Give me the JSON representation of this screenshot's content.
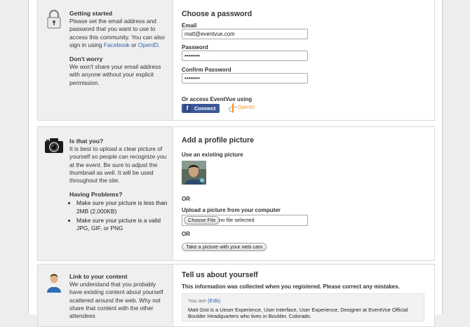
{
  "password_section": {
    "sidebar": {
      "heading1": "Getting started",
      "text1_pre": "Please set the email address and password that you want to use to access this community. You can also sign in using ",
      "link_facebook": "Facebook",
      "text_or": " or ",
      "link_openid": "OpenID",
      "text_end": ".",
      "heading2": "Don't worry",
      "text2": "We won't share your email address with anyone without your explicit permission."
    },
    "title": "Choose a password",
    "email_label": "Email",
    "email_value": "matt@eventvue.com",
    "password_label": "Password",
    "password_value": "••••••••",
    "confirm_label": "Confirm Password",
    "confirm_value": "••••••••",
    "access_label": "Or access EventVue using",
    "facebook_button": "Connect",
    "openid_button": "OpenID"
  },
  "picture_section": {
    "sidebar": {
      "heading1": "Is that you?",
      "text1": "It is best to upload a clear picture of yourself so people can recognize you at the event. Be sure to adjust the thumbnail as well. It will be used throughout the site.",
      "heading2": "Having Problems?",
      "bullets": [
        "Make sure your picture is less than 2MB (2,000KB)",
        "Make sure your picture is a valid JPG, GIF, or PNG"
      ]
    },
    "title": "Add a profile picture",
    "existing_label": "Use an existing picture",
    "or1": "OR",
    "upload_label": "Upload a picture from your computer",
    "choose_file": "Choose File",
    "no_file": "no file selected",
    "or2": "OR",
    "webcam_button": "Take a picture with your web cam"
  },
  "about_section": {
    "sidebar": {
      "heading1": "Link to your content",
      "text1": "We understand that you probably have existing content about yourself scattered around the web. Why not share that content with the other attendees"
    },
    "title": "Tell us about yourself",
    "subtitle": "This information was collected when you registered. Please correct any mistakes.",
    "you_are": "You are",
    "edit_link": "(Edit)",
    "description": "Matt Gist is a Ueser Experience, User Interface, User Experience, Designer at EventVue Official Boulder Headquarters who lives in Boulder, Colorado."
  },
  "icons": {
    "lock": "lock-icon",
    "camera": "camera-icon",
    "user": "user-icon",
    "facebook": "facebook-icon",
    "openid": "openid-icon"
  },
  "colors": {
    "link": "#2a61b4",
    "facebook": "#3b5998",
    "openid": "#f7931e",
    "sidebar_bg": "#efefef"
  }
}
